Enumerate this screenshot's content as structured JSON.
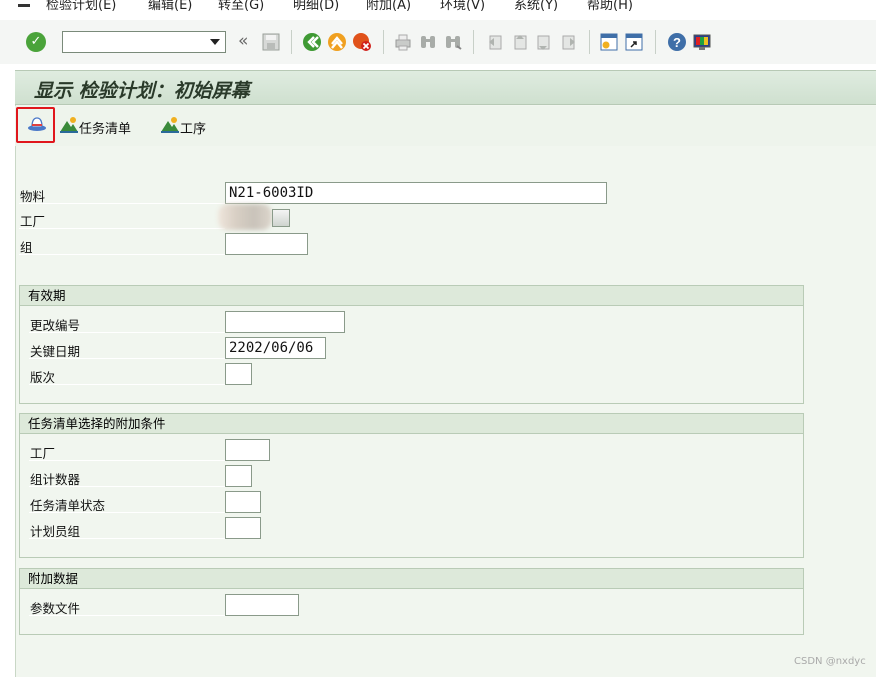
{
  "menu": [
    "检验计划(E)",
    "编辑(E)",
    "转至(G)",
    "明细(D)",
    "附加(A)",
    "环境(V)",
    "系统(Y)",
    "帮助(H)"
  ],
  "toolbar": {
    "command_value": "",
    "icons": [
      "enter-icon",
      "back-icon",
      "exit-icon",
      "cancel-icon",
      "print-icon",
      "find-icon",
      "find-next-icon",
      "first-page-icon",
      "prev-page-icon",
      "next-page-icon",
      "last-page-icon",
      "create-session-icon",
      "shortcut-icon",
      "help-icon",
      "layout-icon"
    ]
  },
  "title": "显示 检验计划：初始屏幕",
  "app_toolbar": {
    "task_list": "任务清单",
    "operations": "工序"
  },
  "fields": {
    "material_label": "物料",
    "material_value": "N21-6003ID",
    "plant_label": "工厂",
    "group_label": "组"
  },
  "validity": {
    "header": "有效期",
    "change_number_label": "更改编号",
    "key_date_label": "关键日期",
    "key_date_value": "2202/06/06",
    "revision_label": "版次"
  },
  "selection": {
    "header": "任务清单选择的附加条件",
    "plant_label": "工厂",
    "group_counter_label": "组计数器",
    "task_list_status_label": "任务清单状态",
    "planner_group_label": "计划员组"
  },
  "additional": {
    "header": "附加数据",
    "parameter_file_label": "参数文件"
  },
  "watermark": "CSDN @nxdyc",
  "colors": {
    "highlight": "#e0161c",
    "panel": "#f1f6ef",
    "accent_green": "#4aa33a"
  }
}
